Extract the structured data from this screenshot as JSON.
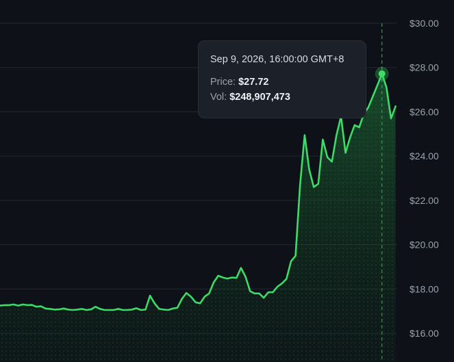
{
  "chart_data": {
    "type": "area",
    "ylim": [
      15,
      30.4
    ],
    "y_ticks": [
      "$16.00",
      "$18.00",
      "$20.00",
      "$22.00",
      "$24.00",
      "$26.00",
      "$28.00",
      "$30.00"
    ],
    "y_tick_values": [
      16,
      18,
      20,
      22,
      24,
      26,
      28,
      30
    ],
    "grid": true,
    "price_axis_side": "right",
    "values": [
      17.25,
      17.27,
      17.27,
      17.3,
      17.25,
      17.3,
      17.27,
      17.28,
      17.2,
      17.22,
      17.12,
      17.1,
      17.07,
      17.08,
      17.12,
      17.07,
      17.05,
      17.07,
      17.1,
      17.05,
      17.08,
      17.2,
      17.1,
      17.05,
      17.05,
      17.05,
      17.1,
      17.05,
      17.05,
      17.07,
      17.13,
      17.05,
      17.07,
      17.7,
      17.35,
      17.1,
      17.07,
      17.05,
      17.12,
      17.15,
      17.55,
      17.82,
      17.65,
      17.4,
      17.35,
      17.65,
      17.8,
      18.3,
      18.6,
      18.52,
      18.47,
      18.52,
      18.5,
      18.95,
      18.55,
      17.9,
      17.8,
      17.8,
      17.6,
      17.85,
      17.85,
      18.1,
      18.25,
      18.45,
      19.25,
      19.5,
      22.7,
      24.95,
      23.4,
      22.6,
      22.75,
      24.75,
      23.95,
      23.75,
      24.95,
      25.8,
      24.15,
      24.85,
      25.4,
      25.3,
      25.9,
      26.2,
      26.7,
      27.2,
      27.72,
      27.1,
      25.7,
      26.25
    ],
    "highlight_index": 84,
    "tooltip": {
      "date": "Sep 9, 2026, 16:00:00 GMT+8",
      "price_label": "Price:",
      "price": "$27.72",
      "vol_label": "Vol:",
      "vol": "$248,907,473"
    },
    "colors": {
      "background": "#0e1117",
      "line": "#3ddc68",
      "area_top": "#1f7a3a",
      "grid": "#232832",
      "tick_label": "#9aa3ad",
      "crosshair": "#2f9e52"
    }
  }
}
